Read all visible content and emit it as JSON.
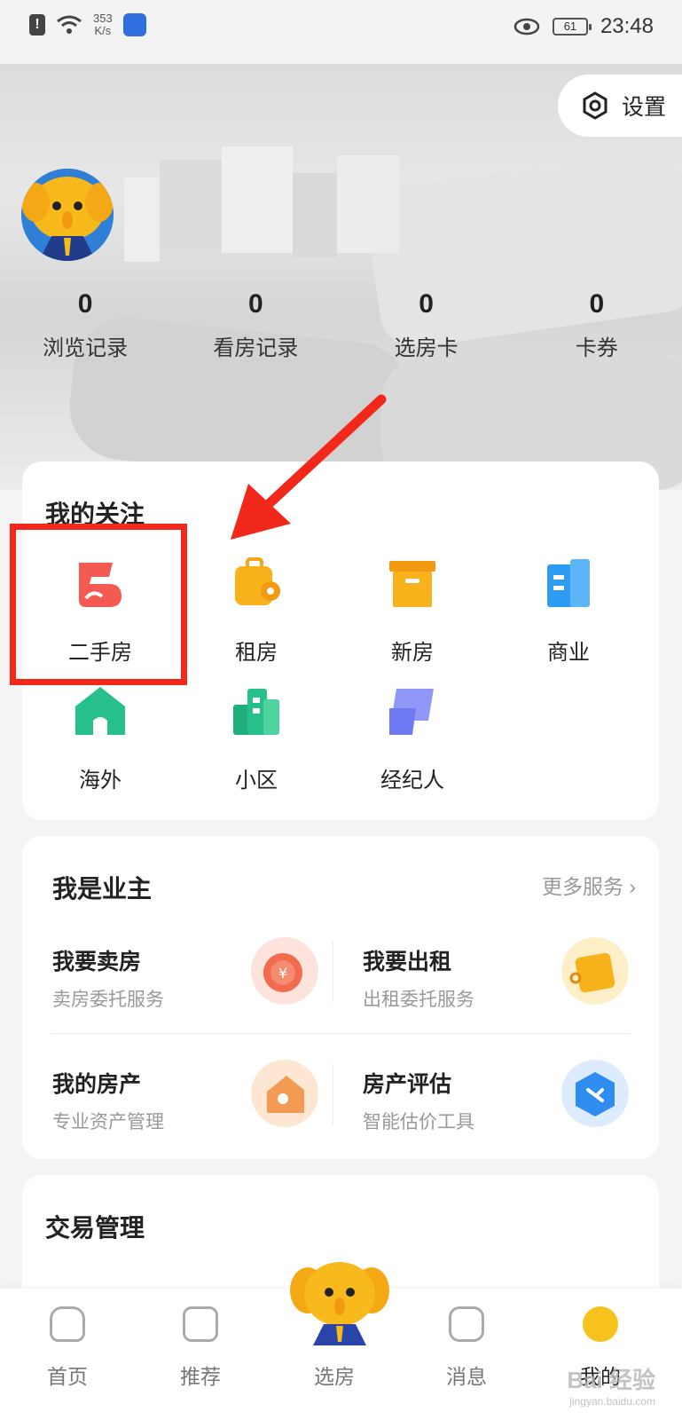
{
  "status_bar": {
    "speed": "353",
    "speed_unit": "K/s",
    "battery": "61",
    "time": "23:48"
  },
  "header": {
    "settings_label": "设置"
  },
  "stats": [
    {
      "value": "0",
      "label": "浏览记录"
    },
    {
      "value": "0",
      "label": "看房记录"
    },
    {
      "value": "0",
      "label": "选房卡"
    },
    {
      "value": "0",
      "label": "卡券"
    }
  ],
  "follow": {
    "title": "我的关注",
    "items": [
      {
        "label": "二手房",
        "icon": "secondhand-house-icon",
        "color": "#f25a52"
      },
      {
        "label": "租房",
        "icon": "luggage-icon",
        "color": "#f7a51c"
      },
      {
        "label": "新房",
        "icon": "box-icon",
        "color": "#f7a51c"
      },
      {
        "label": "商业",
        "icon": "office-building-icon",
        "color": "#2f9cf4"
      },
      {
        "label": "海外",
        "icon": "overseas-house-icon",
        "color": "#27c08a"
      },
      {
        "label": "小区",
        "icon": "community-icon",
        "color": "#27c08a"
      },
      {
        "label": "经纪人",
        "icon": "agent-icon",
        "color": "#6e79f2"
      }
    ]
  },
  "owner": {
    "title": "我是业主",
    "more": "更多服务",
    "services": [
      {
        "title": "我要卖房",
        "subtitle": "卖房委托服务",
        "icon": "coin-icon"
      },
      {
        "title": "我要出租",
        "subtitle": "出租委托服务",
        "icon": "key-box-icon"
      },
      {
        "title": "我的房产",
        "subtitle": "专业资产管理",
        "icon": "house-icon"
      },
      {
        "title": "房产评估",
        "subtitle": "智能估价工具",
        "icon": "evaluation-icon"
      }
    ]
  },
  "trade": {
    "title": "交易管理"
  },
  "bottom_nav": [
    {
      "label": "首页",
      "icon": "home-icon"
    },
    {
      "label": "推荐",
      "icon": "trend-icon"
    },
    {
      "label": "选房",
      "icon": "mascot-icon"
    },
    {
      "label": "消息",
      "icon": "message-icon"
    },
    {
      "label": "我的",
      "icon": "profile-icon"
    }
  ],
  "watermark": {
    "text": "Bai 经验",
    "sub": "jingyan.baidu.com"
  }
}
